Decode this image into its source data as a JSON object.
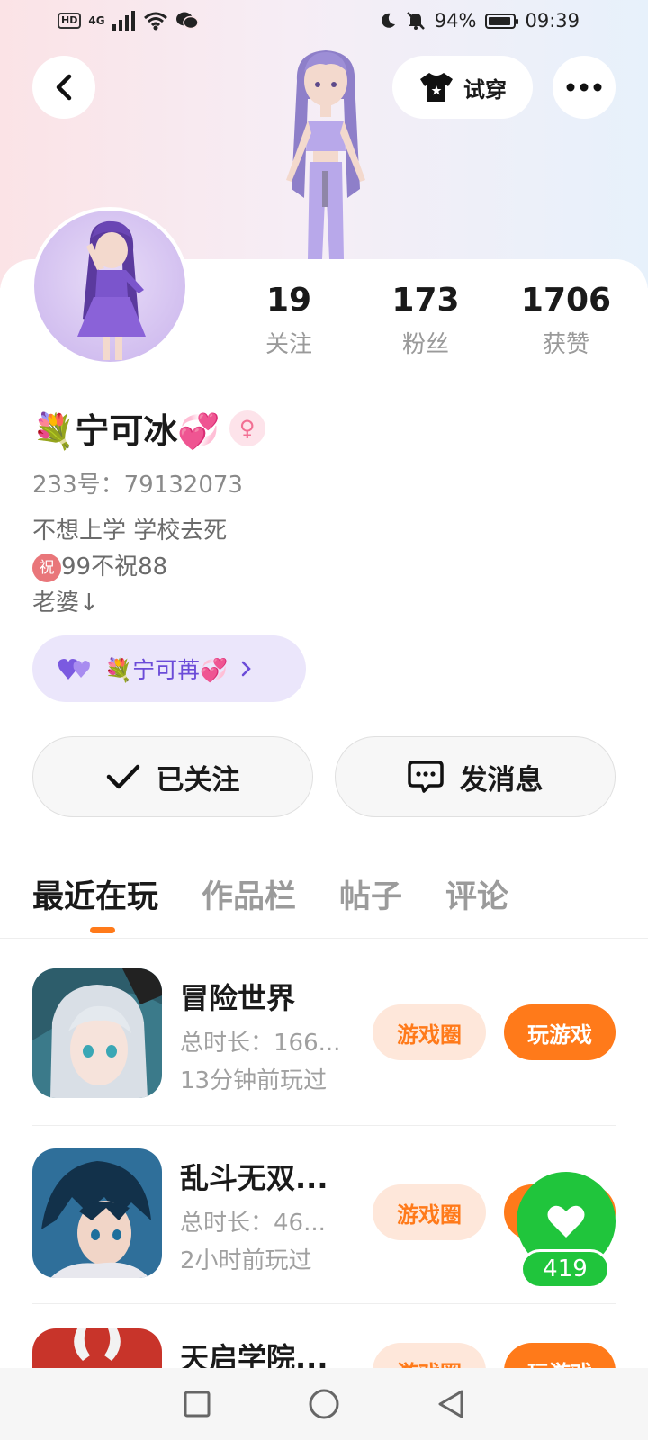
{
  "status_bar": {
    "network": "4G",
    "hd": "HD",
    "battery": "94%",
    "time": "09:39"
  },
  "header": {
    "try_on_label": "试穿"
  },
  "stats": [
    {
      "value": "19",
      "label": "关注"
    },
    {
      "value": "173",
      "label": "粉丝"
    },
    {
      "value": "1706",
      "label": "获赞"
    }
  ],
  "profile": {
    "name": "💐宁可冰💞",
    "gender_symbol": "♀",
    "uid": "233号：79132073",
    "bio_line1": "不想上学 学校去死",
    "bio_line2_prefix": "祝",
    "bio_line2": "99不祝88",
    "bio_line3": "老婆↓",
    "partner_name": "💐宁可苒💞"
  },
  "actions": {
    "followed_label": "已关注",
    "message_label": "发消息"
  },
  "tabs": [
    {
      "label": "最近在玩",
      "active": true
    },
    {
      "label": "作品栏",
      "active": false
    },
    {
      "label": "帖子",
      "active": false
    },
    {
      "label": "评论",
      "active": false
    }
  ],
  "games": [
    {
      "title": "冒险世界",
      "duration": "总时长：166...",
      "last_played": "13分钟前玩过",
      "circle_label": "游戏圈",
      "play_label": "玩游戏"
    },
    {
      "title": "乱斗无双...",
      "duration": "总时长：46...",
      "last_played": "2小时前玩过",
      "circle_label": "游戏圈",
      "play_label": "玩游戏"
    },
    {
      "title": "天启学院...",
      "duration": "",
      "last_played": "",
      "circle_label": "游戏圈",
      "play_label": "玩游戏"
    }
  ],
  "like_fab": {
    "count": "419"
  },
  "colors": {
    "accent_orange": "#ff7a1a",
    "like_green": "#20c53c",
    "partner_purple": "#6b4bd8"
  }
}
